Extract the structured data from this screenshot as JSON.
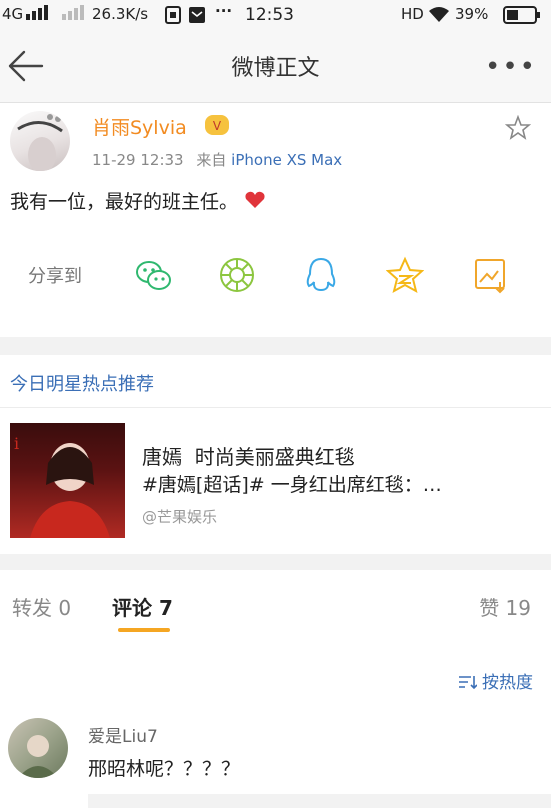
{
  "status_bar": {
    "network": "4G",
    "speed": "26.3K/s",
    "time": "12:53",
    "hd": "HD",
    "battery": "39%"
  },
  "nav": {
    "title": "微博正文"
  },
  "post": {
    "author": "肖雨Sylvia",
    "time": "11-29 12:33",
    "source_prefix": "来自",
    "source": "iPhone XS Max",
    "content": "我有一位，最好的班主任。"
  },
  "share": {
    "label": "分享到",
    "icons": [
      "wechat-icon",
      "moments-icon",
      "qq-icon",
      "qzone-star-icon",
      "save-image-icon"
    ]
  },
  "recommend": {
    "header": "今日明星热点推荐",
    "title": "唐嫣  时尚美丽盛典红毯",
    "desc": "#唐嫣[超话]# 一身红出席红毯：…",
    "source": "@芒果娱乐"
  },
  "tabs": {
    "repost": "转发 0",
    "comment": "评论 7",
    "like": "赞 19"
  },
  "sort": {
    "label": "按热度"
  },
  "comments": [
    {
      "user": "爱是Liu7",
      "text": "邢昭林呢？？？？"
    }
  ],
  "colors": {
    "accent": "#f5a623",
    "link": "#3b6fb6",
    "username": "#f28b21",
    "heart": "#e0343a"
  }
}
